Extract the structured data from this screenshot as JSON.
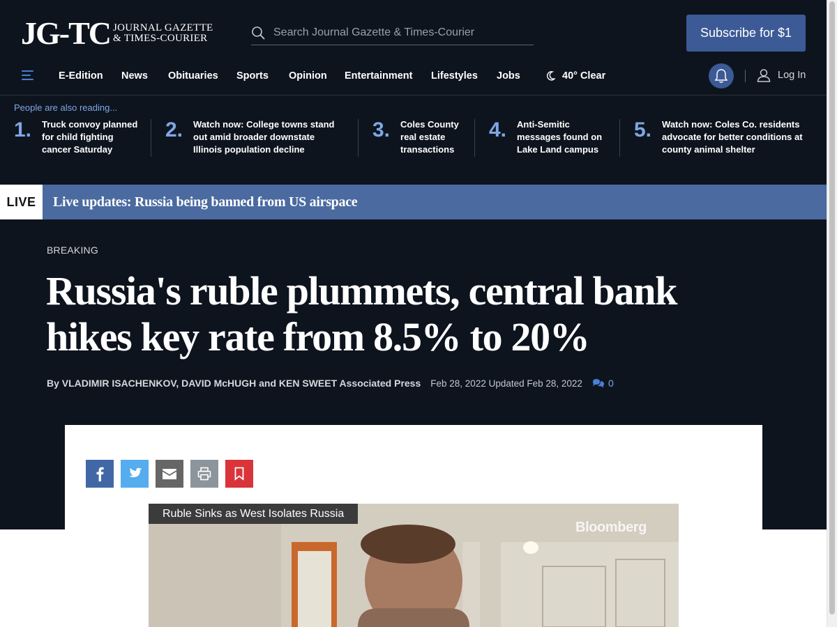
{
  "header": {
    "logo_mark": "JG-TC",
    "logo_line1": "JOURNAL GAZETTE",
    "logo_line2": "& TIMES-COURIER",
    "search_placeholder": "Search Journal Gazette & Times-Courier",
    "subscribe_label": "Subscribe for $1"
  },
  "nav": {
    "items": [
      "E-Edition",
      "News",
      "Obituaries",
      "Sports",
      "Opinion",
      "Entertainment",
      "Lifestyles",
      "Jobs"
    ],
    "weather": "40° Clear",
    "login": "Log In"
  },
  "trending": {
    "label": "People are also reading...",
    "items": [
      {
        "num": "1.",
        "lines": [
          "Truck convoy planned",
          "for child fighting",
          "cancer Saturday"
        ]
      },
      {
        "num": "2.",
        "lines": [
          "Watch now: College towns stand",
          "out amid broader downstate",
          "Illinois population decline"
        ]
      },
      {
        "num": "3.",
        "lines": [
          "Coles County",
          "real estate",
          "transactions"
        ]
      },
      {
        "num": "4.",
        "lines": [
          "Anti-Semitic",
          "messages found on",
          "Lake Land campus"
        ]
      },
      {
        "num": "5.",
        "lines": [
          "Watch now: Coles Co. residents",
          "advocate for better conditions at",
          "county animal shelter"
        ]
      }
    ]
  },
  "live": {
    "tag": "LIVE",
    "text": "Live updates: Russia being banned from US airspace"
  },
  "article": {
    "kicker": "BREAKING",
    "headline_line1": "Russia's ruble plummets, central bank",
    "headline_line2": "hikes key rate from 8.5% to 20%",
    "byline": "By VLADIMIR ISACHENKOV, DAVID McHUGH and KEN SWEET Associated Press",
    "dates": "Feb 28, 2022 Updated Feb 28, 2022",
    "comment_count": "0"
  },
  "video": {
    "title": "Ruble Sinks as West Isolates Russia",
    "brand": "Bloomberg"
  },
  "colors": {
    "background": "#0e141e",
    "accent": "#3c5a96",
    "link": "#7fa7e6",
    "live_banner": "#4a6aa0",
    "facebook": "#4267a6",
    "twitter": "#55acee",
    "email": "#666666",
    "print": "#8c959b",
    "bookmark": "#d9343a"
  },
  "icons": [
    "search-icon",
    "hamburger-icon",
    "moon-icon",
    "bell-icon",
    "user-icon",
    "comment-icon",
    "facebook-icon",
    "twitter-icon",
    "email-icon",
    "print-icon",
    "bookmark-icon"
  ]
}
